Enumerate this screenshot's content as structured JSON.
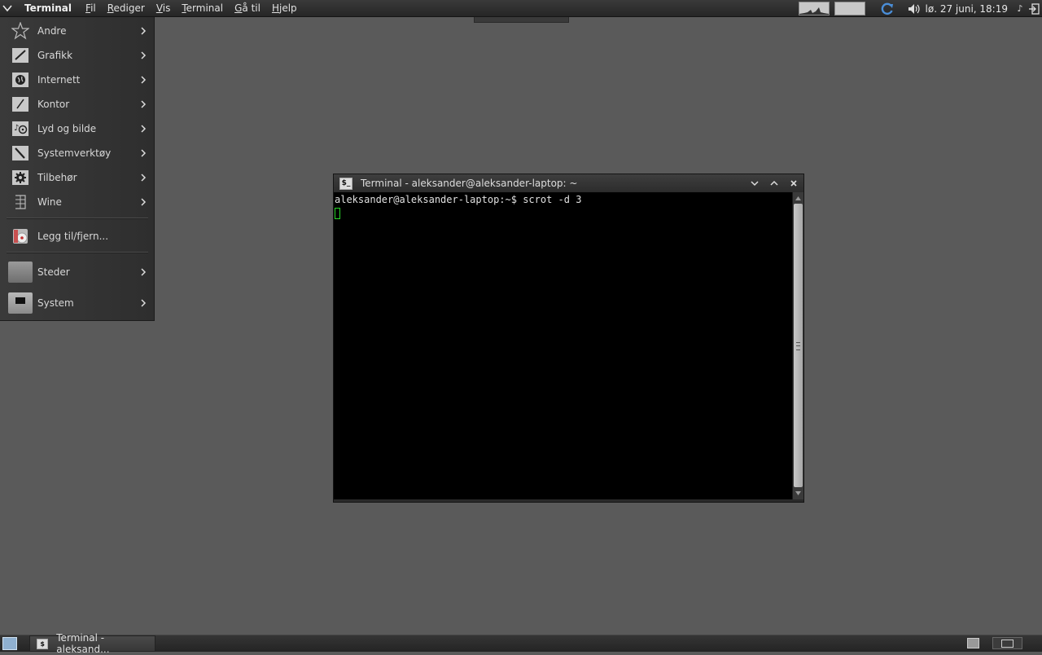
{
  "top_panel": {
    "active_app": "Terminal",
    "menus": [
      {
        "pre": "",
        "u": "F",
        "post": "il"
      },
      {
        "pre": "",
        "u": "R",
        "post": "ediger"
      },
      {
        "pre": "",
        "u": "V",
        "post": "is"
      },
      {
        "pre": "",
        "u": "T",
        "post": "erminal"
      },
      {
        "pre": "",
        "u": "G",
        "post": "å til"
      },
      {
        "pre": "",
        "u": "H",
        "post": "jelp"
      }
    ],
    "clock": "lø. 27 juni, 18:19"
  },
  "app_menu": {
    "items": [
      {
        "label": "Andre",
        "icon": "star-icon"
      },
      {
        "label": "Grafikk",
        "icon": "graphics-icon"
      },
      {
        "label": "Internett",
        "icon": "globe-icon"
      },
      {
        "label": "Kontor",
        "icon": "office-icon"
      },
      {
        "label": "Lyd og bilde",
        "icon": "multimedia-icon"
      },
      {
        "label": "Systemverktøy",
        "icon": "system-tools-icon"
      },
      {
        "label": "Tilbehør",
        "icon": "accessories-icon"
      },
      {
        "label": "Wine",
        "icon": "wine-icon"
      }
    ],
    "add_remove": "Legg til/fjern...",
    "places": "Steder",
    "system": "System"
  },
  "terminal": {
    "title": "Terminal - aleksander@aleksander-laptop: ~",
    "prompt_line": "aleksander@aleksander-laptop:~$ scrot -d 3"
  },
  "taskbar": {
    "task_label": "Terminal - aleksand..."
  }
}
